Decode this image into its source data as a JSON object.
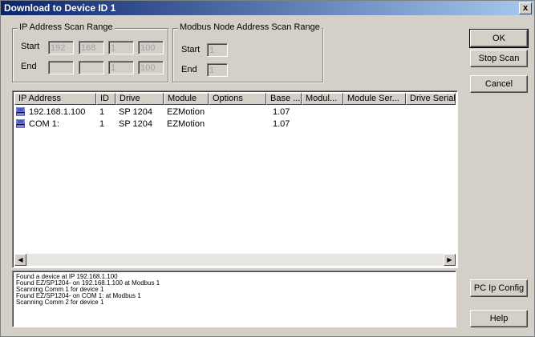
{
  "window": {
    "title": "Download to Device ID 1",
    "close_label": "x"
  },
  "ip_scan": {
    "title": "IP Address Scan Range",
    "start_label": "Start",
    "end_label": "End",
    "start": [
      "192",
      "168",
      "1",
      "100"
    ],
    "end": [
      "",
      "",
      "1",
      "100"
    ]
  },
  "modbus_scan": {
    "title": "Modbus Node Address Scan Range",
    "start_label": "Start",
    "end_label": "End",
    "start": "1",
    "end": "1"
  },
  "buttons": {
    "ok": "OK",
    "stop_scan": "Stop Scan",
    "cancel": "Cancel",
    "pc_ip_config": "PC Ip Config",
    "help": "Help"
  },
  "table": {
    "columns": [
      "IP Address",
      "ID",
      "Drive",
      "Module",
      "Options",
      "Base ...",
      "Modul...",
      "Module Ser...",
      "Drive Serial"
    ],
    "rows": [
      [
        "192.168.1.100",
        "1",
        "SP 1204",
        "EZMotion",
        "",
        "1.07",
        "",
        "",
        ""
      ],
      [
        "COM 1:",
        "1",
        "SP 1204",
        "EZMotion",
        "",
        "1.07",
        "",
        "",
        ""
      ]
    ]
  },
  "log": [
    "Found a device at IP 192.168.1.100",
    "Found EZ/SP1204- on 192.168.1.100 at Modbus 1",
    "Scanning Comm 1 for device 1",
    "Found EZ/SP1204- on COM 1: at Modbus 1",
    "Scanning Comm 2 for device 1"
  ],
  "icons": {
    "device": "computer-device-icon",
    "scroll_left": "arrow-left-icon",
    "scroll_right": "arrow-right-icon"
  },
  "colors": {
    "titlebar_start": "#0a246a",
    "titlebar_end": "#a6caf0",
    "face": "#d4d0c8"
  }
}
